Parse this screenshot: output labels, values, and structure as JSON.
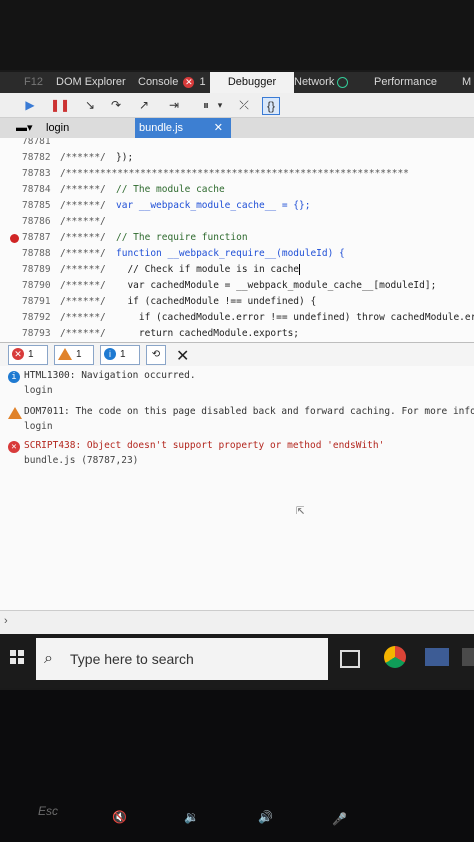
{
  "devtools": {
    "tabs": {
      "f12": "F12",
      "dom_explorer": "DOM Explorer",
      "console": "Console",
      "console_count": "1",
      "debugger": "Debugger",
      "network": "Network",
      "performance": "Performance",
      "overflow": "M"
    },
    "file_tabs": {
      "login": "login",
      "bundle": "bundle.js",
      "close": "✕"
    },
    "code_lines": [
      {
        "ln": "78781",
        "cm": "",
        "src": ""
      },
      {
        "ln": "78782",
        "cm": "/******/",
        "src": "});"
      },
      {
        "ln": "78783",
        "cm": "/************************************************************",
        "src": ""
      },
      {
        "ln": "78784",
        "cm": "/******/",
        "src": "// The module cache"
      },
      {
        "ln": "78785",
        "cm": "/******/",
        "src": "var __webpack_module_cache__ = {};"
      },
      {
        "ln": "78786",
        "cm": "/******/",
        "src": ""
      },
      {
        "ln": "78787",
        "cm": "/******/",
        "src": "// The require function"
      },
      {
        "ln": "78788",
        "cm": "/******/",
        "src": "function __webpack_require__(moduleId) {"
      },
      {
        "ln": "78789",
        "cm": "/******/",
        "src": "  // Check if module is in cache"
      },
      {
        "ln": "78790",
        "cm": "/******/",
        "src": "  var cachedModule = __webpack_module_cache__[moduleId];"
      },
      {
        "ln": "78791",
        "cm": "/******/",
        "src": "  if (cachedModule !== undefined) {"
      },
      {
        "ln": "78792",
        "cm": "/******/",
        "src": "    if (cachedModule.error !== undefined) throw cachedModule.er"
      },
      {
        "ln": "78793",
        "cm": "/******/",
        "src": "    return cachedModule.exports;"
      }
    ],
    "console_filters": {
      "errors": "1",
      "warnings": "1",
      "info": "1"
    },
    "messages": [
      {
        "type": "info",
        "text": "HTML1300: Navigation occurred.",
        "source": "login"
      },
      {
        "type": "warning",
        "text": "DOM7011: The code on this page disabled back and forward caching. For more info",
        "source": "login"
      },
      {
        "type": "error",
        "text": "SCRIPT438: Object doesn't support property or method 'endsWith'",
        "source": "bundle.js (78787,23)"
      }
    ]
  },
  "taskbar": {
    "search_placeholder": "Type here to search"
  },
  "keyboard": {
    "esc": "Esc"
  },
  "colors": {
    "accent": "#3d7fd2",
    "error": "#d83b3b",
    "warning": "#e0822a",
    "info": "#1f7ad1"
  }
}
